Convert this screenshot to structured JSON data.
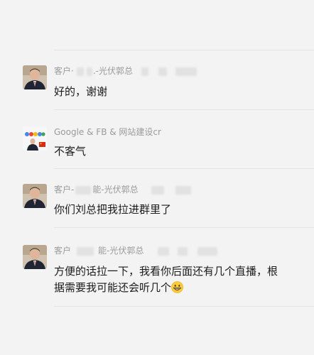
{
  "messages": [
    {
      "sender_prefix": "客户·",
      "sender_mid": ".-光伏郭总",
      "sender_suffix": "",
      "text": "好的，谢谢",
      "avatar_icon": "person-portrait-icon"
    },
    {
      "sender_prefix": "Google & FB & 网站建设cr",
      "sender_mid": "",
      "sender_suffix": "",
      "text": "不客气",
      "avatar_icon": "google-logo-avatar-icon"
    },
    {
      "sender_prefix": "客户-",
      "sender_mid": "能-光伏郭总",
      "sender_suffix": "",
      "text": "你们刘总把我拉进群里了",
      "avatar_icon": "person-portrait-icon"
    },
    {
      "sender_prefix": "客户",
      "sender_mid": "能-光伏郭总",
      "sender_suffix": "",
      "text_line1": "方便的话拉一下，我看你后面还有几个直播，根",
      "text_line2": "据需要我可能还会听几个",
      "emoji": "grinning-face-icon",
      "avatar_icon": "person-portrait-icon"
    }
  ],
  "colors": {
    "background": "#f3f3f3",
    "sender_text": "#9b9b9b",
    "message_text": "#1b1b1b",
    "divider": "#e3e3e3"
  }
}
